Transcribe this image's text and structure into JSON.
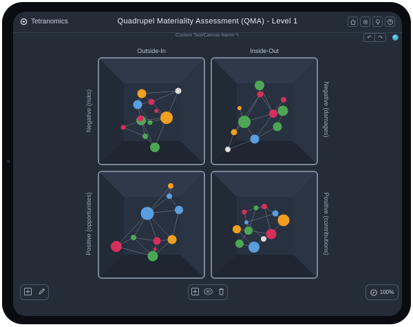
{
  "app": {
    "brand": "Tetranomics",
    "title": "Quadrupel Materiality Assessment (QMA) - Level 1",
    "canvas_name": "Custom Tool/Canvas Name"
  },
  "top_icons": [
    "home-icon",
    "gear-icon",
    "lightbulb-icon",
    "help-icon"
  ],
  "history": {
    "undo_icon": "undo-icon",
    "redo_icon": "redo-icon"
  },
  "columns": {
    "left": "Outside-In",
    "right": "Inside-Out"
  },
  "rows": {
    "left_top": "Negative (risks)",
    "right_top": "Negative (damages)",
    "left_bottom": "Positive (opportunities)",
    "right_bottom": "Positive (contributions)"
  },
  "colors": {
    "orange": "#f0a020",
    "red": "#d4305a",
    "blue": "#5a9ee0",
    "green": "#4da655",
    "white": "#dcdcdc"
  },
  "zoom": "100%"
}
